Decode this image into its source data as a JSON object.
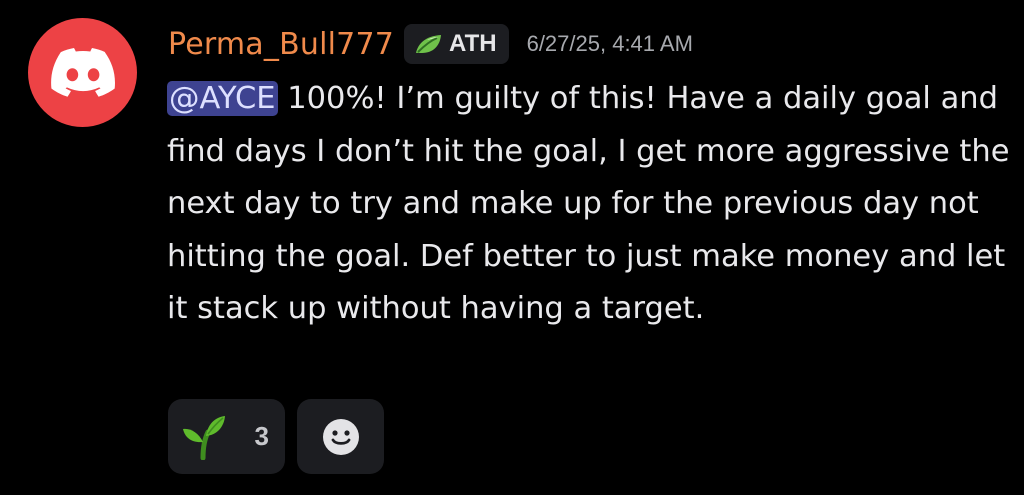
{
  "message": {
    "author": "Perma_Bull777",
    "role_tag": {
      "label": "ATH",
      "icon": "leaf-icon"
    },
    "timestamp": "6/27/25, 4:41 AM",
    "avatar_icon": "discord-logo-icon",
    "mention": "@AYCE",
    "text": " 100%! I’m guilty of this! Have a daily goal and find days I don’t hit the goal, I get more aggressive the next day to try and make up for the previous day not hitting the goal. Def better to just make money and let it stack up without having a target."
  },
  "reactions": [
    {
      "emoji": "seedling",
      "count": "3"
    },
    {
      "emoji": "add-reaction",
      "count": ""
    }
  ],
  "colors": {
    "background": "#000000",
    "avatar": "#ed4245",
    "username": "#f08a4b",
    "mention_bg": "#3e4391",
    "reaction_bg": "#1c1d21"
  }
}
